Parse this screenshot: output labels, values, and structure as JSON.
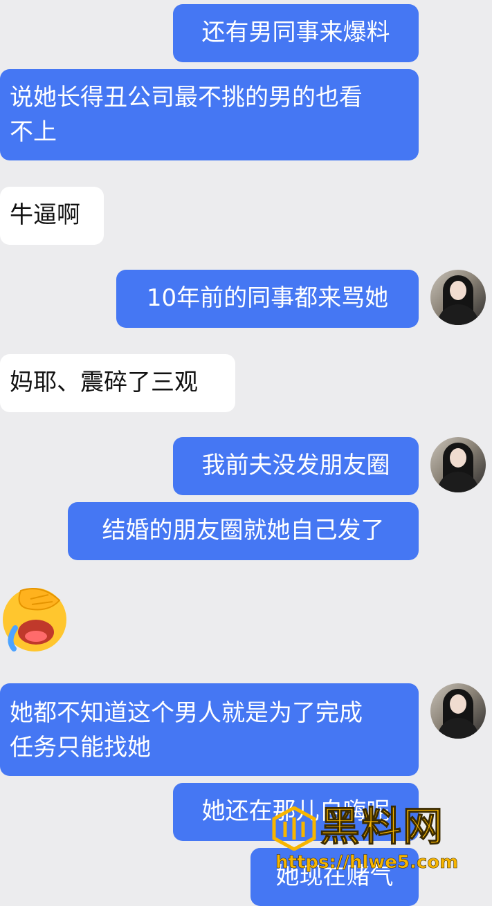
{
  "messages": [
    {
      "side": "out",
      "text": "还有男同事来爆料"
    },
    {
      "side": "out",
      "text": "说她长得丑公司最不挑的男的也看\n不上"
    },
    {
      "side": "in",
      "text": "牛逼啊"
    },
    {
      "side": "out",
      "text": "10年前的同事都来骂她"
    },
    {
      "side": "in",
      "text": "妈耶、震碎了三观"
    },
    {
      "side": "out",
      "text": "我前夫没发朋友圈"
    },
    {
      "side": "out",
      "text": "结婚的朋友圈就她自己发了"
    },
    {
      "side": "out",
      "text": "她都不知道这个男人就是为了完成\n任务只能找她"
    },
    {
      "side": "out",
      "text": "她还在那儿自嗨呢"
    },
    {
      "side": "out",
      "text": "她现在赌气"
    }
  ],
  "emoji": "face-with-hand-over-eye-laughing-emoji",
  "watermark": {
    "title": "黑料网",
    "url": "https://hlwe5.com"
  },
  "colors": {
    "outgoing_bubble": "#4577f3",
    "incoming_bubble": "#ffffff",
    "background": "#ececee",
    "watermark": "#f7b500"
  }
}
